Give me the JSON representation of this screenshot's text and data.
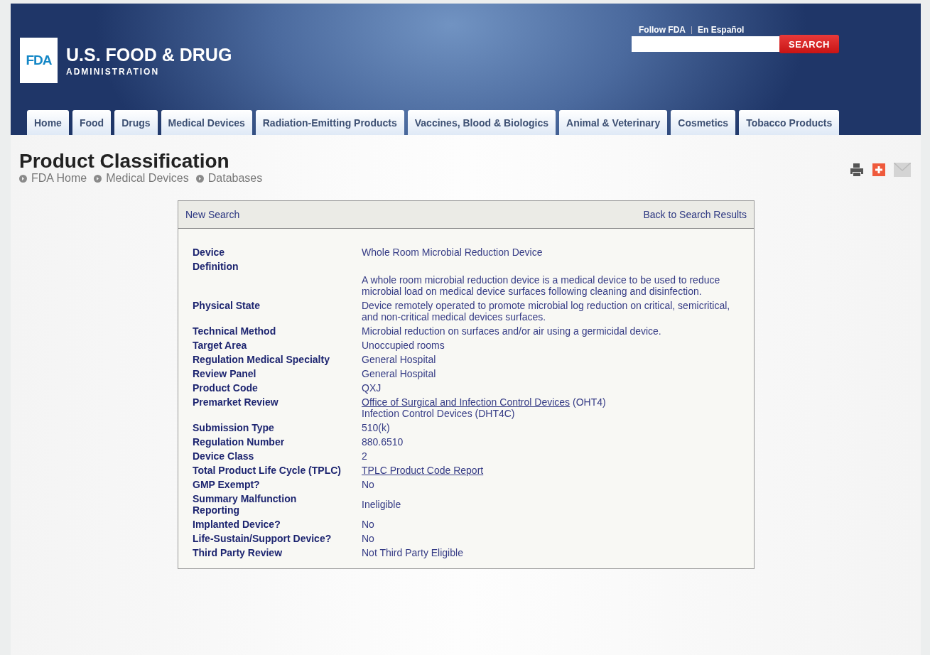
{
  "header": {
    "logo_mark": "FDA",
    "title": "U.S. FOOD & DRUG",
    "subtitle": "ADMINISTRATION",
    "utility_links": [
      "Follow FDA",
      "En Español"
    ],
    "search_button": "SEARCH"
  },
  "nav_tabs": [
    "Home",
    "Food",
    "Drugs",
    "Medical Devices",
    "Radiation-Emitting Products",
    "Vaccines, Blood & Biologics",
    "Animal & Veterinary",
    "Cosmetics",
    "Tobacco Products"
  ],
  "page_title": "Product Classification",
  "breadcrumbs": [
    "FDA Home",
    "Medical Devices",
    "Databases"
  ],
  "card": {
    "left_link": "New Search",
    "right_link": "Back to Search Results",
    "rows": [
      {
        "label": "Device",
        "kind": "plain",
        "value": [
          [
            {
              "text": "Whole Room Microbial Reduction Device",
              "link": false
            }
          ]
        ]
      },
      {
        "label": "Definition",
        "kind": "below",
        "value": [
          [
            {
              "text": "A whole room microbial reduction device is a medical device to be used to reduce microbial load on medical device surfaces following cleaning and disinfection.",
              "link": false
            }
          ]
        ]
      },
      {
        "label": "Physical State",
        "kind": "plain",
        "value": [
          [
            {
              "text": "Device remotely operated to promote microbial log reduction on critical, semicritical, and non-critical medical devices surfaces.",
              "link": false
            }
          ]
        ]
      },
      {
        "label": "Technical Method",
        "kind": "plain",
        "value": [
          [
            {
              "text": "Microbial reduction on surfaces and/or air using a germicidal device.",
              "link": false
            }
          ]
        ]
      },
      {
        "label": "Target Area",
        "kind": "plain",
        "value": [
          [
            {
              "text": "Unoccupied rooms",
              "link": false
            }
          ]
        ]
      },
      {
        "label": "Regulation Medical Specialty",
        "kind": "plain",
        "value": [
          [
            {
              "text": "General Hospital",
              "link": false
            }
          ]
        ]
      },
      {
        "label": "Review Panel",
        "kind": "plain",
        "value": [
          [
            {
              "text": "General Hospital",
              "link": false
            }
          ]
        ]
      },
      {
        "label": "Product Code",
        "kind": "plain",
        "value": [
          [
            {
              "text": "QXJ",
              "link": false
            }
          ]
        ]
      },
      {
        "label": "Premarket Review",
        "kind": "plain",
        "value": [
          [
            {
              "text": "Office of Surgical and Infection Control Devices",
              "link": true
            },
            {
              "text": " (OHT4)",
              "link": false
            }
          ],
          [
            {
              "text": "Infection Control Devices (DHT4C)",
              "link": false
            }
          ]
        ]
      },
      {
        "label": "Submission Type",
        "kind": "plain",
        "value": [
          [
            {
              "text": "510(k)",
              "link": false
            }
          ]
        ]
      },
      {
        "label": "Regulation Number",
        "kind": "plain",
        "value": [
          [
            {
              "text": "880.6510",
              "link": false
            }
          ]
        ]
      },
      {
        "label": "Device Class",
        "kind": "plain",
        "value": [
          [
            {
              "text": "2",
              "link": false
            }
          ]
        ]
      },
      {
        "label": "Total Product Life Cycle (TPLC)",
        "kind": "plain",
        "value": [
          [
            {
              "text": "TPLC Product Code Report",
              "link": true
            }
          ]
        ]
      },
      {
        "label": "GMP Exempt?",
        "kind": "plain",
        "value": [
          [
            {
              "text": "No",
              "link": false
            }
          ]
        ]
      },
      {
        "label": "Summary Malfunction Reporting",
        "kind": "centered",
        "value": [
          [
            {
              "text": "Ineligible",
              "link": false
            }
          ]
        ]
      },
      {
        "label": "Implanted Device?",
        "kind": "plain",
        "value": [
          [
            {
              "text": "No",
              "link": false
            }
          ]
        ]
      },
      {
        "label": "Life-Sustain/Support Device?",
        "kind": "plain",
        "value": [
          [
            {
              "text": "No",
              "link": false
            }
          ]
        ]
      },
      {
        "label": "Third Party Review",
        "kind": "plain",
        "value": [
          [
            {
              "text": "Not Third Party Eligible",
              "link": false
            }
          ]
        ]
      }
    ]
  }
}
